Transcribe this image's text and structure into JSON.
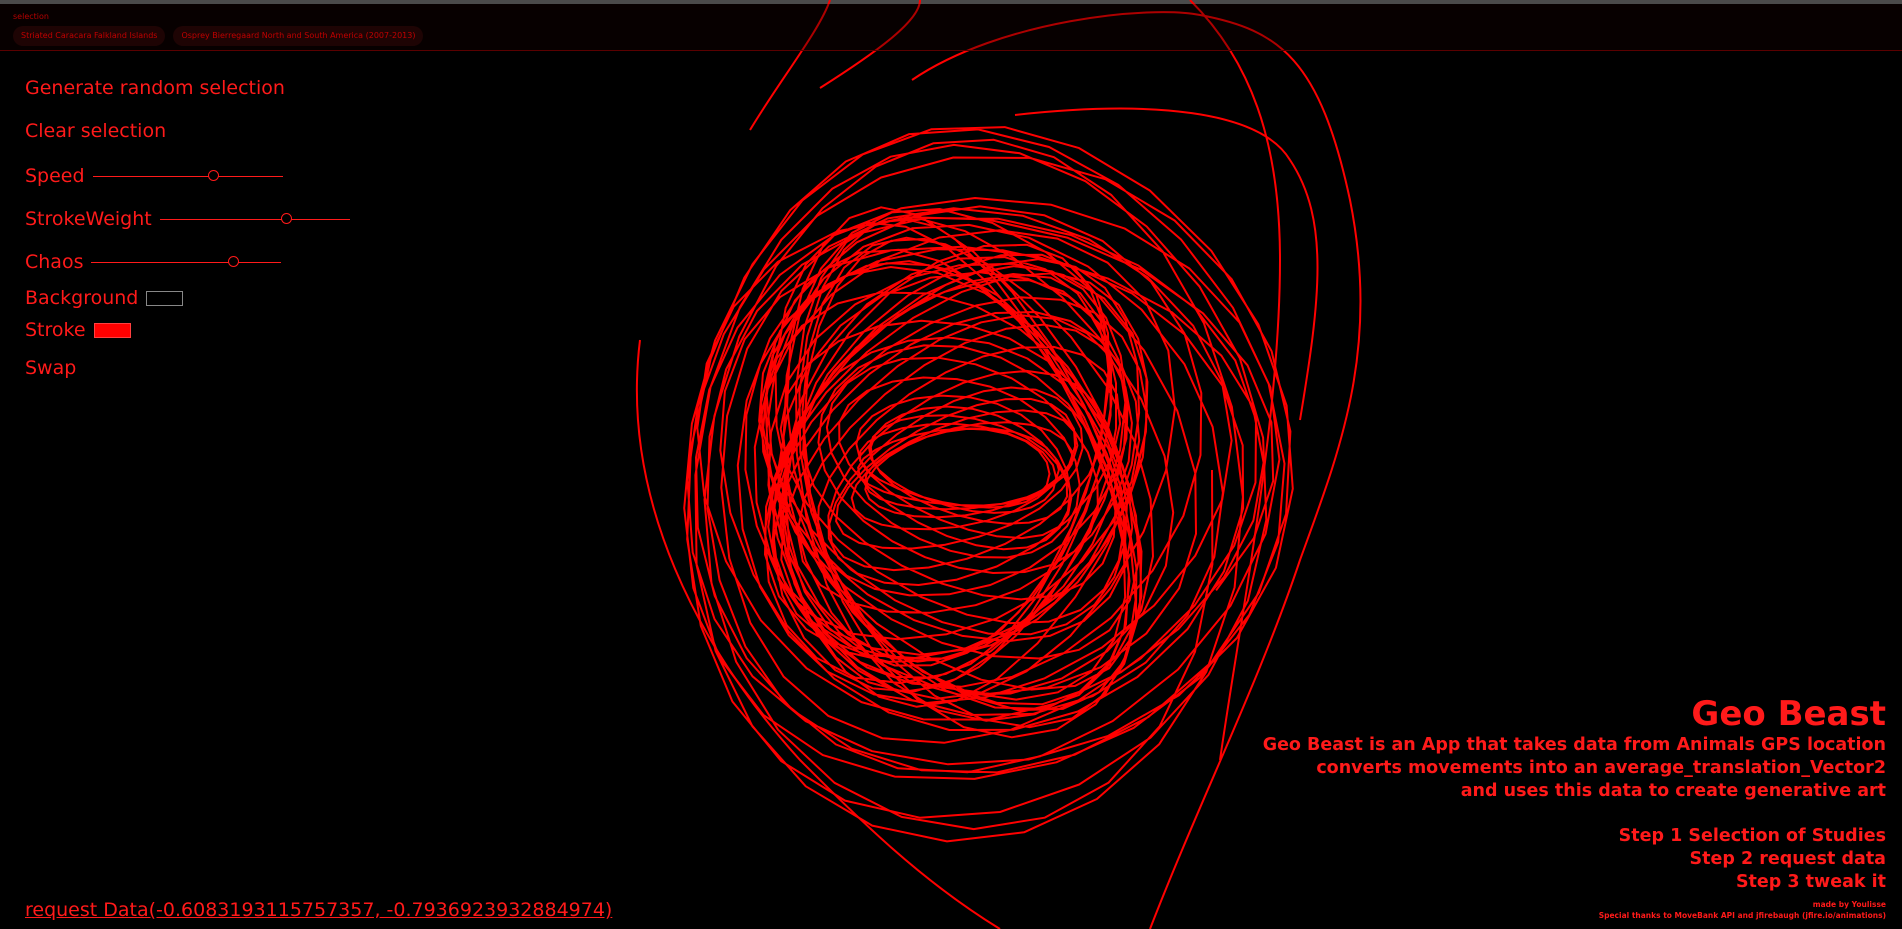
{
  "selection": {
    "title": "selection",
    "chips": [
      "Striated Caracara Falkland Islands",
      "Osprey Bierregaard North and South America (2007-2013)"
    ]
  },
  "controls": {
    "generate_label": "Generate random selection",
    "clear_label": "Clear selection",
    "speed_label": "Speed",
    "speed_value": 0.64,
    "stroke_weight_label": "StrokeWeight",
    "stroke_weight_value": 0.67,
    "chaos_label": "Chaos",
    "chaos_value": 0.75,
    "background_label": "Background",
    "background_color": "#000000",
    "stroke_label": "Stroke",
    "stroke_color": "#ff0000",
    "swap_label": "Swap"
  },
  "request_link": "request Data(-0.6083193115757357, -0.7936923932884974)",
  "info": {
    "title": "Geo Beast",
    "description": [
      "Geo Beast is an App that takes data from Animals GPS location",
      "converts movements into an average_translation_Vector2",
      "and uses this data to create generative art"
    ],
    "steps": [
      "Step 1 Selection of Studies",
      "Step 2 request data",
      "Step 3 tweak it"
    ],
    "credits": [
      "made by Youlisse",
      "Special thanks to MoveBank API and jfirebaugh (jfire.io/animations)"
    ]
  },
  "colors": {
    "accent": "#ff1a1a",
    "background": "#000000"
  }
}
